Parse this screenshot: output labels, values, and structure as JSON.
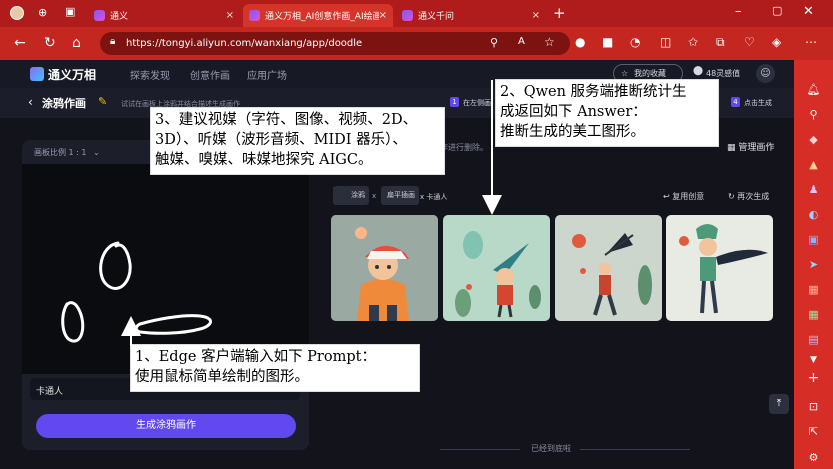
{
  "browser": {
    "tabs": [
      {
        "label": "通义"
      },
      {
        "label": "通义万相_AI创意作画_AI绘画_人..."
      },
      {
        "label": "通义千问"
      }
    ],
    "url": "https://tongyi.aliyun.com/wanxiang/app/doodle",
    "accent": "#c42620"
  },
  "app": {
    "logo_text": "通义万相",
    "nav": [
      "探索发现",
      "创意作画",
      "应用广场"
    ],
    "collection_label": "我的收藏",
    "credits_label": "48灵感值",
    "page_title": "涂鸦作画",
    "page_hint": "试试在画板上涂鸦并结合描述生成画作",
    "step1_num": "1",
    "step1_text": "在左侧画",
    "step4_num": "4",
    "step4_text": "点击生成",
    "canvas_ratio": "画板比例  1 : 1",
    "prompt_value": "卡通人",
    "generate_label": "生成涂鸦画作",
    "gallery_note": "作进行删除。",
    "manage_label": "管理画作",
    "chip_doodle": "涂鸦",
    "chip_style": "扁平插画",
    "chip_sep": "x",
    "chip_prompt": "x 卡通人",
    "reuse_label": "复用创意",
    "regen_label": "再次生成",
    "end_label": "已经到底啦",
    "accent": "#6148f0"
  },
  "annotations": {
    "a1_line1": "1、Edge 客户端输入如下 Prompt：",
    "a1_line2": "使用鼠标简单绘制的图形。",
    "a2_line1": "2、Qwen 服务端推断统计生",
    "a2_line2": "成返回如下 Answer：",
    "a2_line3": "推断生成的美工图形。",
    "a3_line1": "3、建议视媒（字符、图像、视频、2D、",
    "a3_line2": "3D）、听媒（波形音频、MIDI 器乐）、",
    "a3_line3": "触媒、嗅媒、味媒地探究 AIGC。"
  }
}
